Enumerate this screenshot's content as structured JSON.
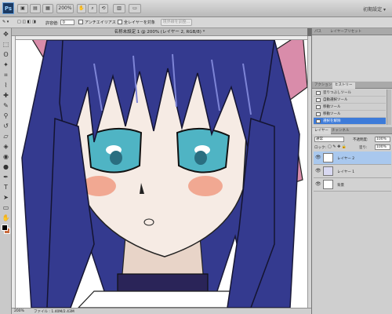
{
  "app": {
    "logo": "Ps",
    "zoom_level": "200%",
    "workspace_label": "初期設定 ▾"
  },
  "options": {
    "feather_label": "許容値:",
    "feather_value": "0",
    "antialias_label": "アンチエイリアス",
    "all_layers_label": "全レイヤーを対象",
    "refine_edge_label": "境界線を調整..."
  },
  "document": {
    "title": "名称未設定 1 @ 200% (レイヤー 2, RGB/8) *",
    "zoom": "200%",
    "file_info": "ファイル : 1.40M/2.43M"
  },
  "panels": {
    "history_tabs": [
      "パス",
      "レイヤープリセット"
    ],
    "history_header_tabs": [
      "アクション",
      "ヒストリー"
    ],
    "history_items": [
      {
        "label": "塗りつぶしツール",
        "selected": false
      },
      {
        "label": "自動選択ツール",
        "selected": false
      },
      {
        "label": "移動ツール",
        "selected": false
      },
      {
        "label": "移動ツール",
        "selected": false
      },
      {
        "label": "選択を解除",
        "selected": true
      }
    ],
    "layers_tabs": [
      "レイヤー",
      "チャンネル"
    ],
    "blend_mode": "通常",
    "opacity_label": "不透明度:",
    "opacity_value": "100%",
    "lock_label": "ロック:",
    "fill_label": "塗り:",
    "fill_value": "100%",
    "layers": [
      {
        "name": "レイヤー 2",
        "selected": true
      },
      {
        "name": "レイヤー 1",
        "selected": false
      },
      {
        "name": "背景",
        "selected": false
      }
    ]
  },
  "colors": {
    "accent": "#3d7bd9",
    "hair": "#343a8f",
    "skin": "#f6ebe4",
    "eye": "#4fb4c4",
    "ribbon": "#d98caa"
  }
}
